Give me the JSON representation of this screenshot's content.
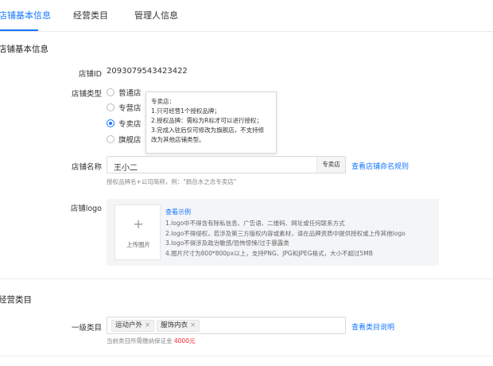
{
  "tabs": [
    {
      "label": "店铺基本信息",
      "active": true
    },
    {
      "label": "经营类目",
      "active": false
    },
    {
      "label": "管理人信息",
      "active": false
    }
  ],
  "basic_section": {
    "title": "店铺基本信息"
  },
  "store_id": {
    "label": "店铺ID",
    "value": "2093079543423422"
  },
  "store_type": {
    "label": "店铺类型",
    "options": [
      {
        "label": "普通店",
        "checked": false
      },
      {
        "label": "专营店",
        "checked": false
      },
      {
        "label": "专卖店",
        "checked": true
      },
      {
        "label": "旗舰店",
        "checked": false
      }
    ],
    "tooltip": [
      "专卖店：",
      "1.只可经营1个授权品牌；",
      "2.授权品牌：需标为R标才可以进行授权；",
      "3.完成入驻后仅可修改为旗舰店，不支持修",
      "改为其他店铺类型。"
    ]
  },
  "store_name": {
    "label": "店铺名称",
    "value": "王小二",
    "suffix": "专卖店",
    "rules_link": "查看店铺命名规则",
    "hint": "授权品牌名+公司简称，例：\"鹤岳水之念专卖店\""
  },
  "store_logo": {
    "label": "店铺logo",
    "upload_label": "上传图片",
    "example_link": "查看示例",
    "rules": [
      "1.logo中不得含有除私信息、广告语、二维码、网址或任何联系方式",
      "2.logo不得侵权，若涉及第三方版权内容或素材，请在品牌资质中提供授权或上传其他logo",
      "3.logo不得涉及政治敏感/恐怖惊悚/过于暴露类",
      "4.图片尺寸为800*800px以上，支持PNG、JPG和JPEG格式，大小不超过5MB"
    ]
  },
  "category_section": {
    "title": "经营类目"
  },
  "primary_category": {
    "label": "一级类目",
    "tags": [
      "运动户外",
      "服饰内衣"
    ],
    "tag_close": "×",
    "link": "查看类目说明",
    "deposit_text": "当前类目所需缴纳保证金",
    "deposit_amount": "4000元"
  },
  "colors": {
    "accent": "#1677ff",
    "danger": "#f5222d"
  }
}
